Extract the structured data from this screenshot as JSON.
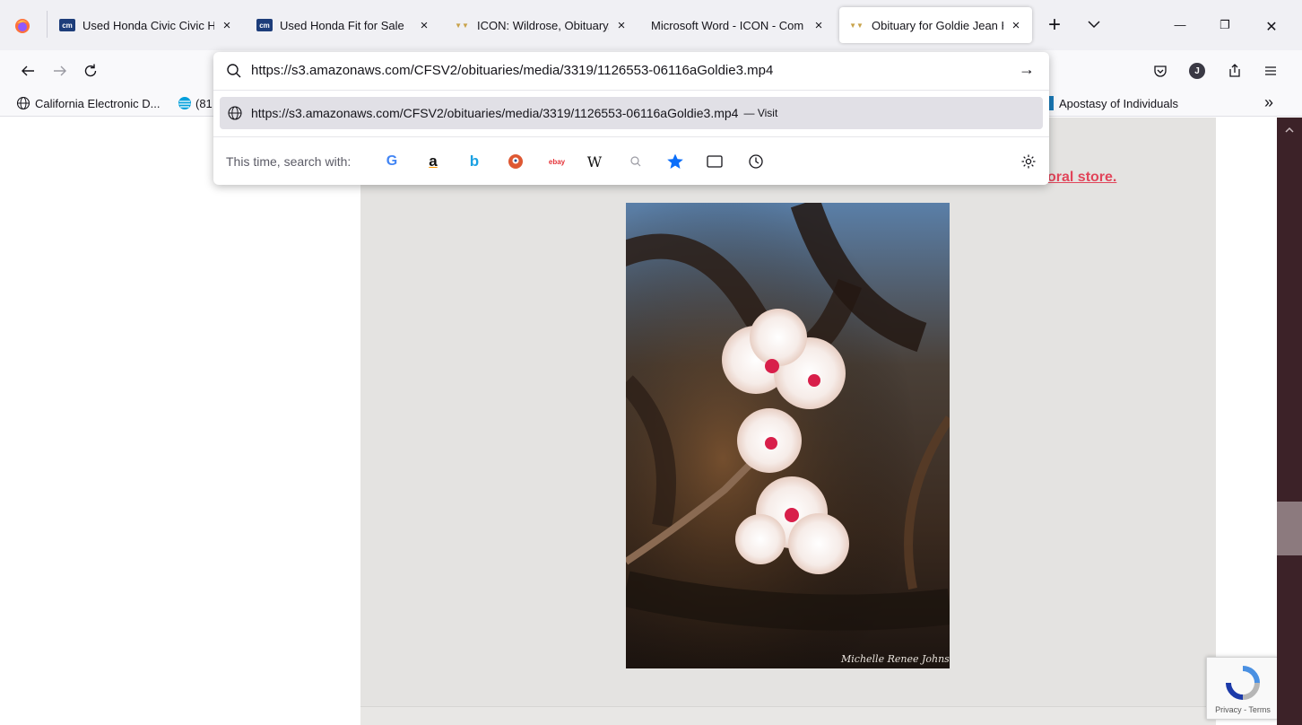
{
  "tabs": [
    {
      "title": "Used Honda Civic Civic Hy",
      "favicon": "cm",
      "active": false
    },
    {
      "title": "Used Honda Fit for Sale",
      "favicon": "cm",
      "active": false
    },
    {
      "title": "ICON: Wildrose, Obituary, ",
      "favicon": "wildrose",
      "active": false
    },
    {
      "title": "Microsoft Word - ICON - Com",
      "favicon": "none",
      "active": false
    },
    {
      "title": "Obituary for Goldie Jean H",
      "favicon": "wildrose",
      "active": true
    }
  ],
  "tab_close_glyph": "×",
  "new_tab_glyph": "+",
  "tab_list_glyph": "⌵",
  "window": {
    "minimize": "—",
    "restore": "❐",
    "close": "✕"
  },
  "urlbar": {
    "value": "https://s3.amazonaws.com/CFSV2/obituaries/media/3319/1126553-06116aGoldie3.mp4",
    "go_glyph": "→"
  },
  "suggestion": {
    "url": "https://s3.amazonaws.com/CFSV2/obituaries/media/3319/1126553-06116aGoldie3.mp4",
    "action": "— Visit"
  },
  "search_with": {
    "label": "This time, search with:",
    "engines": [
      "google",
      "amazon",
      "bing",
      "duckduckgo",
      "ebay",
      "wikipedia",
      "search-shortcut",
      "bookmarks",
      "tabs",
      "history"
    ],
    "google": "G",
    "amazon": "a",
    "bing": "b",
    "ebay": "ebay",
    "wikipedia": "W"
  },
  "bookmarks": [
    {
      "label": "California Electronic D...",
      "icon": "globe-icon"
    },
    {
      "label": "(81",
      "icon": "att-icon"
    },
    {
      "label": "Apostasy of Individuals",
      "icon": "bookmark-icon"
    }
  ],
  "bookmarks_overflow": "»",
  "profile_initial": "J",
  "page": {
    "floral_link": "oral store.",
    "photo_signature": "Michelle Renee Johnson",
    "recaptcha": "Privacy - Terms"
  },
  "colors": {
    "link": "#e1455a",
    "scrollbar": "#3c2228",
    "content_bg": "#e4e3e1",
    "accent_star": "#0b6ef9"
  }
}
